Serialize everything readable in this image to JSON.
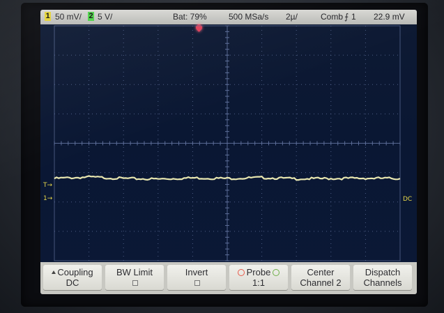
{
  "status_bar": {
    "ch1_number": "1",
    "ch1_scale": "50 mV/",
    "ch2_number": "2",
    "ch2_scale": "5 V/",
    "battery": "Bat: 79%",
    "sample_rate": "500 MSa/s",
    "timebase": "2µ/",
    "trigger_mode": "Comb",
    "trigger_source": "1",
    "measurement": "22.9 mV"
  },
  "markers": {
    "trigger_level": "T→",
    "ch1_ground": "1→",
    "dc_coupling": "DC"
  },
  "menu": {
    "coupling": {
      "title": "Coupling",
      "value": "DC"
    },
    "bw_limit": {
      "title": "BW Limit"
    },
    "invert": {
      "title": "Invert"
    },
    "probe": {
      "title": "Probe",
      "value": "1:1"
    },
    "center": {
      "title": "Center",
      "value": "Channel 2"
    },
    "dispatch": {
      "title": "Dispatch",
      "value": "Channels"
    }
  },
  "colors": {
    "ch1_badge": "#e4d33a",
    "ch2_badge": "#4fd34a",
    "trace": "#e9e7b0",
    "grid": "#5e6f9a",
    "screen": "#0b1836",
    "trigger_marker": "#e0405a"
  },
  "chart_data": {
    "type": "line",
    "grid": {
      "divisions_x": 10,
      "divisions_y": 8
    },
    "series": [
      {
        "values": [
          -1.2,
          -1.15,
          -1.2,
          -1.22,
          -1.18,
          -1.2,
          -1.17,
          -1.21,
          -1.2,
          -1.19,
          -1.2
        ]
      }
    ]
  }
}
